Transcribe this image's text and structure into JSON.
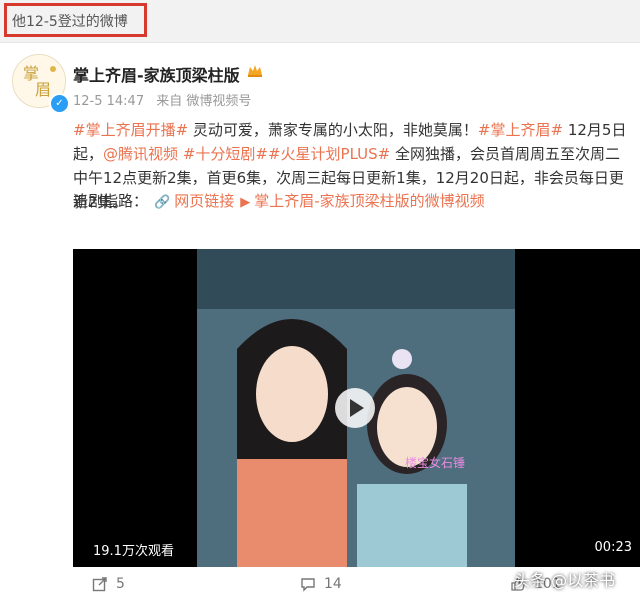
{
  "caption": "他12-5登过的微博",
  "post": {
    "author": "掌上齐眉-家族顶梁柱版",
    "time": "12-5 14:47",
    "source": "来自 微博视频号",
    "text": {
      "t1": "#掌上齐眉开播#",
      "t2": " 灵动可爱，萧家专属的小太阳，非她莫属！",
      "t3": "#掌上齐眉#",
      "t4": " 12月5日起，",
      "t5": "@腾讯视频",
      "t6": " ",
      "t7": "#十分短剧##火星计划PLUS#",
      "t8": " 全网独播，会员首周周五至次周二中午12点更新2集，首更6集，次周三起每日更新1集，12月20日起，非会员每日更新2集。"
    },
    "follow_label": "追剧指路：",
    "follow_link1": "网页链接",
    "follow_link2": "掌上齐眉-家族顶梁柱版的微博视频"
  },
  "video": {
    "views": "19.1万次观看",
    "duration": "00:23",
    "overlay_text": "楼宝女石锤"
  },
  "actions": {
    "share_count": "5",
    "comment_count": "14",
    "like_count": "101"
  },
  "watermark": "头条 @以茶书",
  "colors": {
    "accent": "#eb7350",
    "highlight_border": "#d63a2f",
    "verified": "#2a9df4"
  },
  "icons": [
    "verified-icon",
    "crown-icon",
    "link-icon",
    "video-link-icon",
    "play-icon",
    "share-icon",
    "comment-icon",
    "like-icon"
  ]
}
